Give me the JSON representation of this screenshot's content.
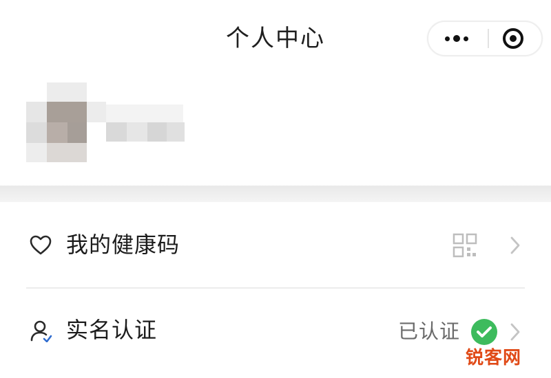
{
  "header": {
    "title": "个人中心",
    "more_icon": "more-dots-icon",
    "close_icon": "target-close-icon"
  },
  "menu": {
    "health_code": {
      "label": "我的健康码",
      "icon": "heart-icon",
      "trailing_icon": "qr-code-icon"
    },
    "real_name": {
      "label": "实名认证",
      "icon": "user-icon",
      "status": "已认证",
      "status_icon": "check-circle-icon",
      "status_color": "#3dbb5d"
    }
  },
  "watermark": "锐客网"
}
